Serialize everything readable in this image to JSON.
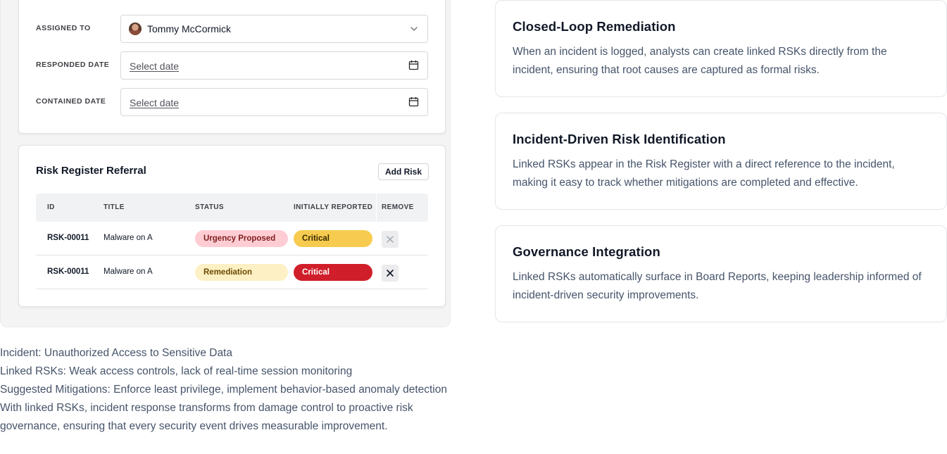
{
  "form": {
    "assigned_label": "ASSIGNED TO",
    "assigned_value": "Tommy McCormick",
    "responded_label": "RESPONDED DATE",
    "responded_placeholder": "Select date",
    "contained_label": "CONTAINED DATE",
    "contained_placeholder": "Select date"
  },
  "risk_register": {
    "title": "Risk Register Referral",
    "add_button": "Add Risk",
    "columns": [
      "ID",
      "TITLE",
      "STATUS",
      "INITIALLY REPORTED",
      "REMOVE"
    ],
    "rows": [
      {
        "id": "RSK-00011",
        "title": "Malware on A",
        "status": "Urgency Proposed",
        "reported": "Critical"
      },
      {
        "id": "RSK-00011",
        "title": "Malware on A",
        "status": "Remediation",
        "reported": "Critical"
      }
    ]
  },
  "description": {
    "lines": [
      "Incident: Unauthorized Access to Sensitive Data",
      "Linked RSKs: Weak access controls, lack of real-time session monitoring",
      "Suggested Mitigations: Enforce least privilege, implement behavior-based anomaly detection",
      "With linked RSKs, incident response transforms from damage control to proactive risk governance, ensuring that every security event drives measurable improvement."
    ]
  },
  "features": [
    {
      "title": "Closed-Loop Remediation",
      "body": "When an incident is logged, analysts can create linked RSKs directly from the incident, ensuring that root causes are captured as formal risks."
    },
    {
      "title": "Incident-Driven Risk Identification",
      "body": "Linked RSKs appear in the Risk Register with a direct reference to the incident, making it easy to track whether mitigations are completed and effective."
    },
    {
      "title": "Governance Integration",
      "body": "Linked RSKs automatically surface in Board Reports, keeping leadership informed of incident-driven security improvements."
    }
  ],
  "colors": {
    "pill_urgency_bg": "#fecdd3",
    "pill_urgency_text": "#7f1d1d",
    "pill_remediation_bg": "#fdf0c4",
    "pill_remediation_text": "#6b4a00",
    "pill_critical_yellow_bg": "#f6cb4f",
    "pill_critical_yellow_text": "#3a2a00",
    "pill_critical_red_bg": "#d01f2a",
    "pill_critical_red_text": "#ffffff"
  },
  "icons": {
    "dropdown": "chevron-down-icon",
    "date": "calendar-icon",
    "remove": "close-icon",
    "user": "avatar"
  }
}
